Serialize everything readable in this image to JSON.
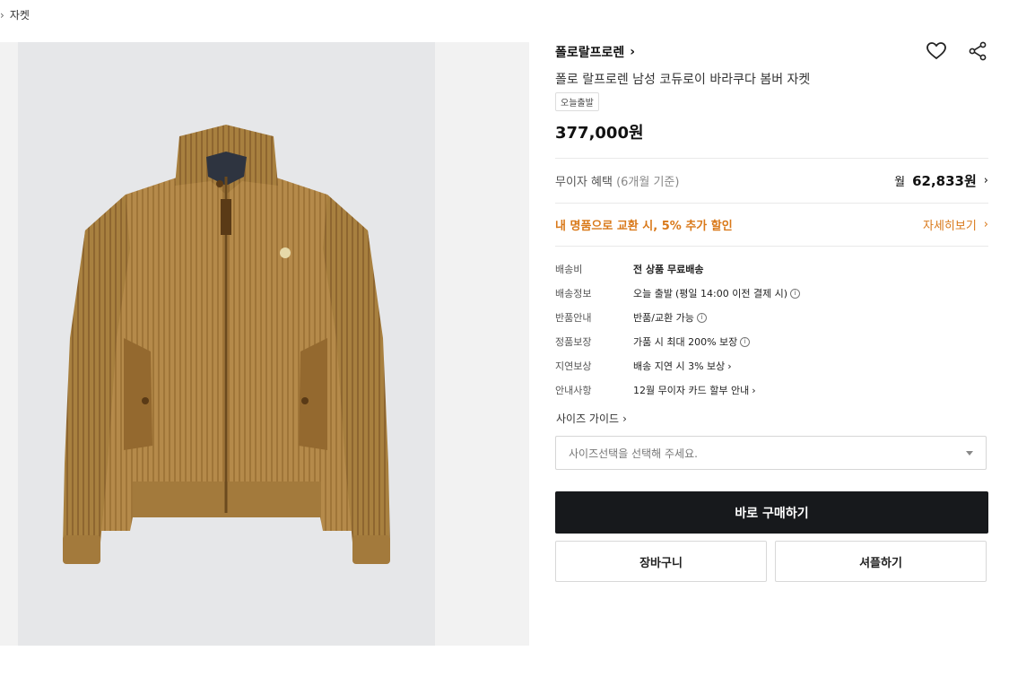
{
  "breadcrumb": {
    "current": "자켓"
  },
  "product": {
    "brand": "폴로랄프로렌",
    "name": "폴로 랄프로렌 남성 코듀로이 바라쿠다 봄버 자켓",
    "tag": "오늘출발",
    "price": "377,000원",
    "image_icon": "corduroy-jacket-image"
  },
  "benefit": {
    "label": "무이자 혜택",
    "sub": "(6개월 기준)",
    "monthly_prefix": "월",
    "monthly_amount": "62,833원"
  },
  "trade": {
    "label": "내 명품으로 교환 시, 5% 추가 할인",
    "link": "자세히보기"
  },
  "details": [
    {
      "key": "배송비",
      "value": "전 상품 무료배송"
    },
    {
      "key": "배송정보",
      "value": "오늘 출발",
      "extra": "(평일 14:00 이전 결제 시)"
    },
    {
      "key": "반품안내",
      "value": "반품/교환 가능"
    },
    {
      "key": "정품보장",
      "value": "가품 시 최대 200% 보장"
    },
    {
      "key": "지연보상",
      "value": "배송 지연 시 3% 보상"
    },
    {
      "key": "안내사항",
      "value": "12월 무이자 카드 할부 안내"
    }
  ],
  "size_guide": "사이즈 가이드",
  "size_select": {
    "placeholder": "사이즈선택을 선택해 주세요."
  },
  "buttons": {
    "buy": "바로 구매하기",
    "cart": "장바구니",
    "share": "셔플하기"
  },
  "colors": {
    "accent_orange": "#d9791a",
    "buy_button": "#17191c"
  }
}
